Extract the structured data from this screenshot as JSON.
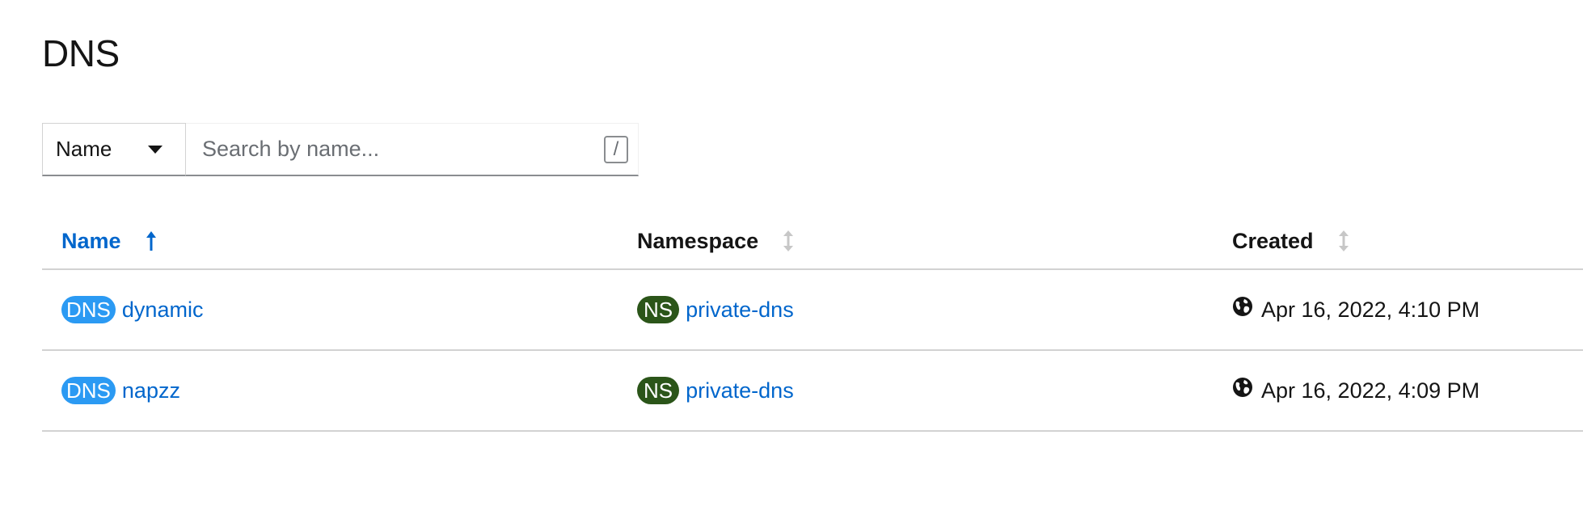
{
  "page": {
    "title": "DNS"
  },
  "toolbar": {
    "filter_selected": "Name",
    "search_placeholder": "Search by name...",
    "search_value": "",
    "kbd_hint": "/"
  },
  "table": {
    "columns": [
      {
        "label": "Name",
        "sorted": "ascending",
        "icon": "sort-arrow-up-icon"
      },
      {
        "label": "Namespace",
        "sorted": "none",
        "icon": "sort-both-icon"
      },
      {
        "label": "Created",
        "sorted": "none",
        "icon": "sort-both-icon"
      }
    ],
    "rows": [
      {
        "kind_badge": "DNS",
        "name": "dynamic",
        "ns_badge": "NS",
        "namespace": "private-dns",
        "created_icon": "globe-icon",
        "created": "Apr 16, 2022, 4:10 PM"
      },
      {
        "kind_badge": "DNS",
        "name": "napzz",
        "ns_badge": "NS",
        "namespace": "private-dns",
        "created_icon": "globe-icon",
        "created": "Apr 16, 2022, 4:09 PM"
      }
    ]
  },
  "colors": {
    "link": "#0066cc",
    "dns_badge": "#2b9af3",
    "ns_badge": "#2b5519",
    "text": "#151515",
    "border": "#d2d2d2"
  }
}
